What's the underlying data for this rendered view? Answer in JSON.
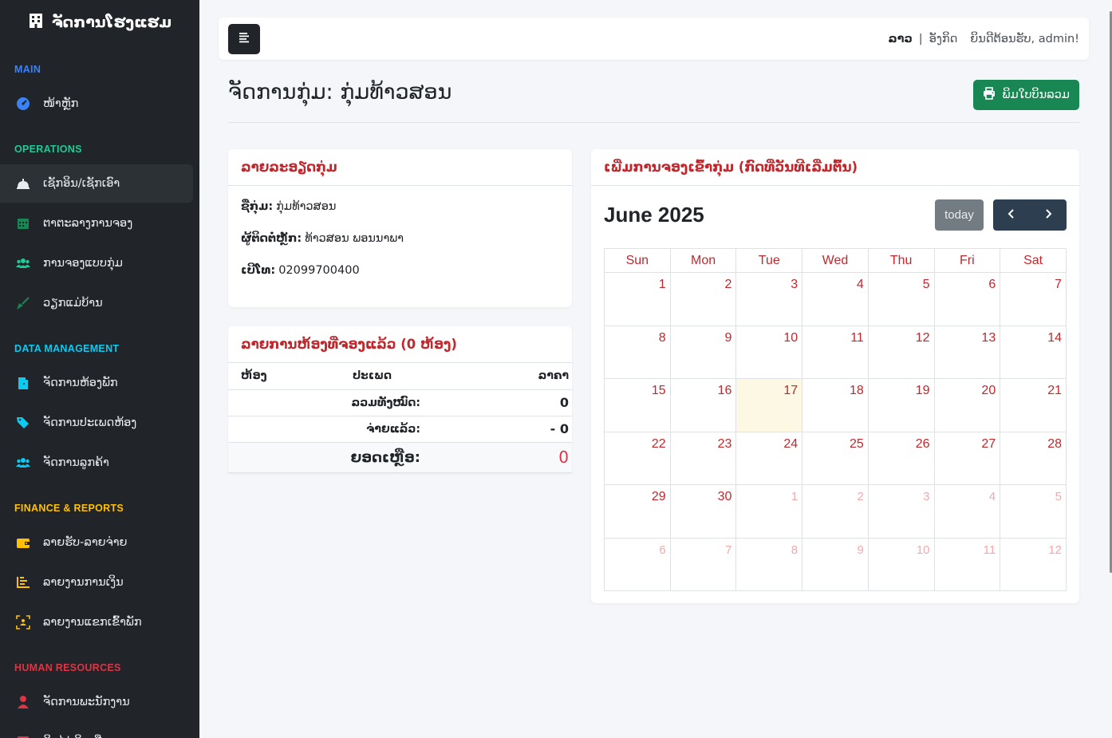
{
  "sidebar": {
    "brand": "ຈັດການໂຮງແຮມ",
    "sections": [
      {
        "title": "MAIN",
        "color": "#3b82f6",
        "items": [
          {
            "label": "ໜ້າຫຼັກ",
            "icon": "dashboard-icon",
            "icon_color": "#3b82f6"
          }
        ]
      },
      {
        "title": "OPERATIONS",
        "color": "#20c997",
        "items": [
          {
            "label": "ເຊັກອິນ/ເຊັກເອົາ",
            "icon": "bell-icon",
            "icon_color": "#e9ecef",
            "active": true
          },
          {
            "label": "ຕາຕະລາງການຈອງ",
            "icon": "calendar-icon",
            "icon_color": "#198754"
          },
          {
            "label": "ການຈອງແບບກຸ່ມ",
            "icon": "users-icon",
            "icon_color": "#20c997"
          },
          {
            "label": "ວຽກແມ່ບ້ານ",
            "icon": "broom-icon",
            "icon_color": "#198754"
          }
        ]
      },
      {
        "title": "DATA MANAGEMENT",
        "color": "#0dcaf0",
        "items": [
          {
            "label": "ຈັດການຫ້ອງພັກ",
            "icon": "door-icon",
            "icon_color": "#0dcaf0"
          },
          {
            "label": "ຈັດການປະເພດຫ້ອງ",
            "icon": "tags-icon",
            "icon_color": "#0dcaf0"
          },
          {
            "label": "ຈັດການລູກຄ້າ",
            "icon": "users-icon",
            "icon_color": "#0dcaf0"
          }
        ]
      },
      {
        "title": "FINANCE & REPORTS",
        "color": "#ffc107",
        "items": [
          {
            "label": "ລາຍຮັບ-ລາຍຈ່າຍ",
            "icon": "wallet-icon",
            "icon_color": "#ffc107"
          },
          {
            "label": "ລາຍງານການເງິນ",
            "icon": "chart-icon",
            "icon_color": "#ffc107"
          },
          {
            "label": "ລາຍງານແຂກເຂົ້າພັກ",
            "icon": "guests-icon",
            "icon_color": "#ffc107"
          }
        ]
      },
      {
        "title": "HUMAN RESOURCES",
        "color": "#dc3545",
        "items": [
          {
            "label": "ຈັດການພະນັກງານ",
            "icon": "employee-icon",
            "icon_color": "#dc3545"
          },
          {
            "label": "ຄິດໄລ່ເງິນເດືອນ",
            "icon": "payroll-icon",
            "icon_color": "#dc3545"
          }
        ]
      }
    ]
  },
  "topbar": {
    "lang_lao": "ລາວ",
    "separator": "|",
    "lang_en": "ອັງກິດ",
    "welcome": "ຍິນດີຕ້ອນຮັບ, admin!"
  },
  "page": {
    "title": "ຈັດການກຸ່ມ: ກຸ່ມທ້າວສອນ",
    "print_label": "ພິມໃບບິນລວມ"
  },
  "group_details": {
    "header": "ລາຍລະອຽດກຸ່ມ",
    "rows": [
      {
        "label": "ຊື່ກຸ່ມ:",
        "value": "ກຸ່ມທ້າວສອນ"
      },
      {
        "label": "ຜູ້ຕິດຕໍ່ຫຼັກ:",
        "value": "ທ້າວສອນ ພອນນາພາ"
      },
      {
        "label": "ເບີໂທ:",
        "value": "02099700400"
      }
    ]
  },
  "booked_rooms": {
    "header": "ລາຍການຫ້ອງທີ່ຈອງແລ້ວ (0 ຫ້ອງ)",
    "columns": [
      "ຫ້ອງ",
      "ປະເພດ",
      "ລາຄາ"
    ],
    "total_label": "ລວມທັງໝົດ:",
    "total_value": "0",
    "paid_label": "ຈ່າຍແລ້ວ:",
    "paid_value": "- 0",
    "balance_label": "ຍອດເຫຼືອ:",
    "balance_value": "0"
  },
  "calendar": {
    "header": "ເພີ່ມການຈອງເຂົ້າກຸ່ມ (ກົດທີ່ວັນທີເລີ່ມຕົ້ນ)",
    "title": "June 2025",
    "today_label": "today",
    "weekdays": [
      "Sun",
      "Mon",
      "Tue",
      "Wed",
      "Thu",
      "Fri",
      "Sat"
    ],
    "weeks": [
      [
        {
          "d": "1"
        },
        {
          "d": "2"
        },
        {
          "d": "3"
        },
        {
          "d": "4"
        },
        {
          "d": "5"
        },
        {
          "d": "6"
        },
        {
          "d": "7"
        }
      ],
      [
        {
          "d": "8"
        },
        {
          "d": "9"
        },
        {
          "d": "10"
        },
        {
          "d": "11"
        },
        {
          "d": "12"
        },
        {
          "d": "13"
        },
        {
          "d": "14"
        }
      ],
      [
        {
          "d": "15"
        },
        {
          "d": "16"
        },
        {
          "d": "17",
          "today": true
        },
        {
          "d": "18"
        },
        {
          "d": "19"
        },
        {
          "d": "20"
        },
        {
          "d": "21"
        }
      ],
      [
        {
          "d": "22"
        },
        {
          "d": "23"
        },
        {
          "d": "24"
        },
        {
          "d": "25"
        },
        {
          "d": "26"
        },
        {
          "d": "27"
        },
        {
          "d": "28"
        }
      ],
      [
        {
          "d": "29"
        },
        {
          "d": "30"
        },
        {
          "d": "1",
          "other": true
        },
        {
          "d": "2",
          "other": true
        },
        {
          "d": "3",
          "other": true
        },
        {
          "d": "4",
          "other": true
        },
        {
          "d": "5",
          "other": true
        }
      ],
      [
        {
          "d": "6",
          "other": true
        },
        {
          "d": "7",
          "other": true
        },
        {
          "d": "8",
          "other": true
        },
        {
          "d": "9",
          "other": true
        },
        {
          "d": "10",
          "other": true
        },
        {
          "d": "11",
          "other": true
        },
        {
          "d": "12",
          "other": true
        }
      ]
    ]
  }
}
